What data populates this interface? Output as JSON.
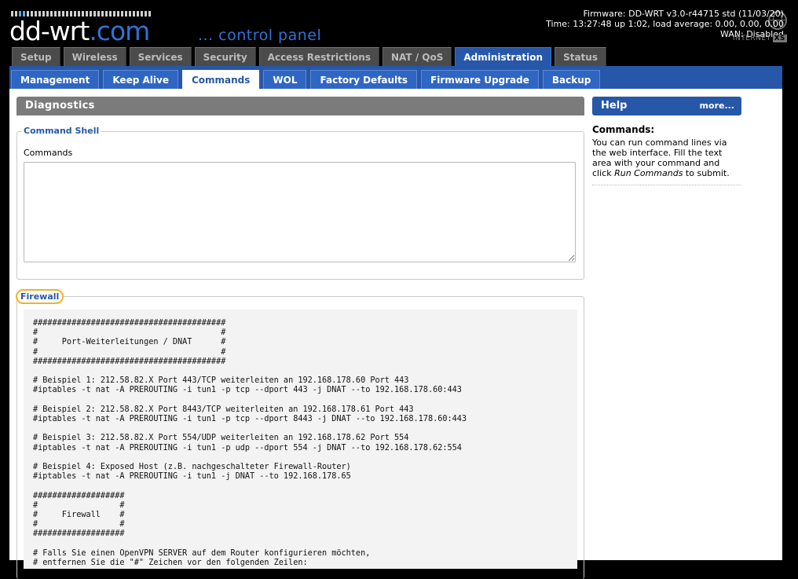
{
  "header": {
    "logo_main": "dd-wrt",
    "logo_suffix": ".com",
    "subtitle": "... control panel",
    "firmware": "Firmware: DD-WRT v3.0-r44715 std (11/03/20)",
    "time": "Time: 13:27:48 up 1:02, load average: 0.00, 0.00, 0.00",
    "wan": "WAN: Disabled",
    "badge_text": "INTERNET",
    "badge_tag": "XS"
  },
  "main_tabs": [
    {
      "label": "Setup",
      "active": false
    },
    {
      "label": "Wireless",
      "active": false
    },
    {
      "label": "Services",
      "active": false
    },
    {
      "label": "Security",
      "active": false
    },
    {
      "label": "Access Restrictions",
      "active": false
    },
    {
      "label": "NAT / QoS",
      "active": false
    },
    {
      "label": "Administration",
      "active": true
    },
    {
      "label": "Status",
      "active": false
    }
  ],
  "sub_tabs": [
    {
      "label": "Management",
      "active": false
    },
    {
      "label": "Keep Alive",
      "active": false
    },
    {
      "label": "Commands",
      "active": true
    },
    {
      "label": "WOL",
      "active": false
    },
    {
      "label": "Factory Defaults",
      "active": false
    },
    {
      "label": "Firmware Upgrade",
      "active": false
    },
    {
      "label": "Backup",
      "active": false
    }
  ],
  "diagnostics": {
    "title": "Diagnostics",
    "command_shell": {
      "legend": "Command Shell",
      "label": "Commands",
      "value": ""
    },
    "firewall": {
      "legend": "Firewall",
      "script": "########################################\n#                                      #\n#     Port-Weiterleitungen / DNAT      #\n#                                      #\n########################################\n\n# Beispiel 1: 212.58.82.X Port 443/TCP weiterleiten an 192.168.178.60 Port 443\n#iptables -t nat -A PREROUTING -i tun1 -p tcp --dport 443 -j DNAT --to 192.168.178.60:443\n\n# Beispiel 2: 212.58.82.X Port 8443/TCP weiterleiten an 192.168.178.61 Port 443\n#iptables -t nat -A PREROUTING -i tun1 -p tcp --dport 8443 -j DNAT --to 192.168.178.60:443\n\n# Beispiel 3: 212.58.82.X Port 554/UDP weiterleiten an 192.168.178.62 Port 554\n#iptables -t nat -A PREROUTING -i tun1 -p udp --dport 554 -j DNAT --to 192.168.178.62:554\n\n# Beispiel 4: Exposed Host (z.B. nachgeschalteter Firewall-Router)\n#iptables -t nat -A PREROUTING -i tun1 -j DNAT --to 192.168.178.65\n\n###################\n#                 #\n#     Firewall    #\n#                 #\n###################\n\n# Falls Sie einen OpenVPN SERVER auf dem Router konfigurieren möchten,\n# entfernen Sie die \"#\" Zeichen vor den folgenden Zeilen:"
    }
  },
  "help": {
    "title": "Help",
    "more": "more...",
    "heading": "Commands:",
    "text_before": "You can run command lines via the web interface. Fill the text area with your command and click ",
    "text_em": "Run Commands",
    "text_after": " to submit."
  },
  "colors": {
    "accent": "#2757a8",
    "header_bg": "#000000",
    "tab_inactive": "#4b4b4b",
    "section_title": "#7b7b7b",
    "highlight": "#f2b228"
  }
}
